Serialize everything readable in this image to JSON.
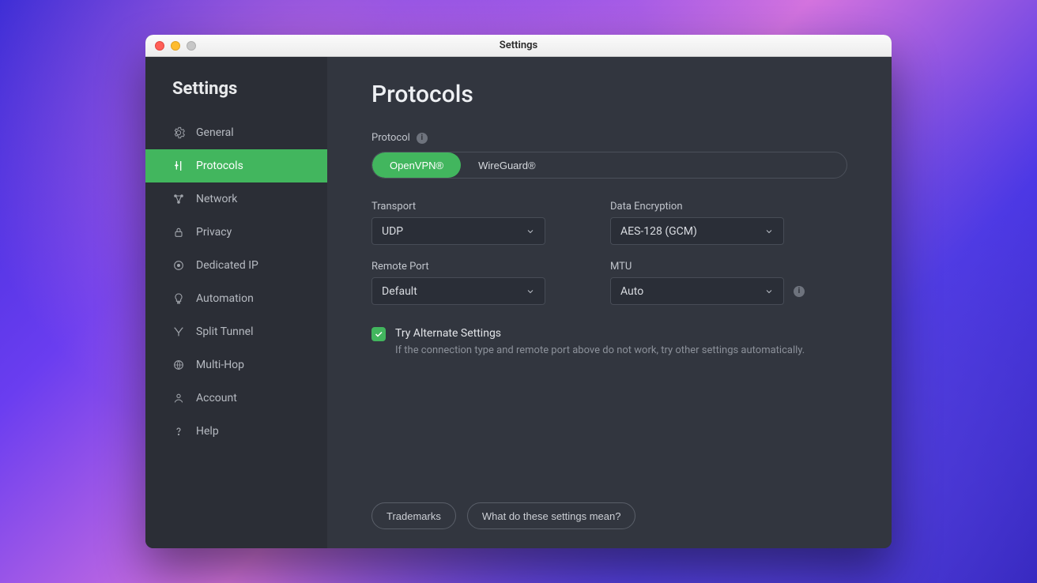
{
  "window": {
    "title": "Settings"
  },
  "sidebar": {
    "heading": "Settings",
    "items": [
      {
        "label": "General"
      },
      {
        "label": "Protocols"
      },
      {
        "label": "Network"
      },
      {
        "label": "Privacy"
      },
      {
        "label": "Dedicated IP"
      },
      {
        "label": "Automation"
      },
      {
        "label": "Split Tunnel"
      },
      {
        "label": "Multi-Hop"
      },
      {
        "label": "Account"
      },
      {
        "label": "Help"
      }
    ]
  },
  "main": {
    "title": "Protocols",
    "protocol_label": "Protocol",
    "segmented": {
      "openvpn": "OpenVPN®",
      "wireguard": "WireGuard®"
    },
    "fields": {
      "transport": {
        "label": "Transport",
        "value": "UDP"
      },
      "data_encryption": {
        "label": "Data Encryption",
        "value": "AES-128 (GCM)"
      },
      "remote_port": {
        "label": "Remote Port",
        "value": "Default"
      },
      "mtu": {
        "label": "MTU",
        "value": "Auto"
      }
    },
    "alternate": {
      "checked": true,
      "title": "Try Alternate Settings",
      "desc": "If the connection type and remote port above do not work, try other settings automatically."
    },
    "footer": {
      "trademarks": "Trademarks",
      "meaning": "What do these settings mean?"
    }
  },
  "colors": {
    "accent": "#42b65e"
  }
}
